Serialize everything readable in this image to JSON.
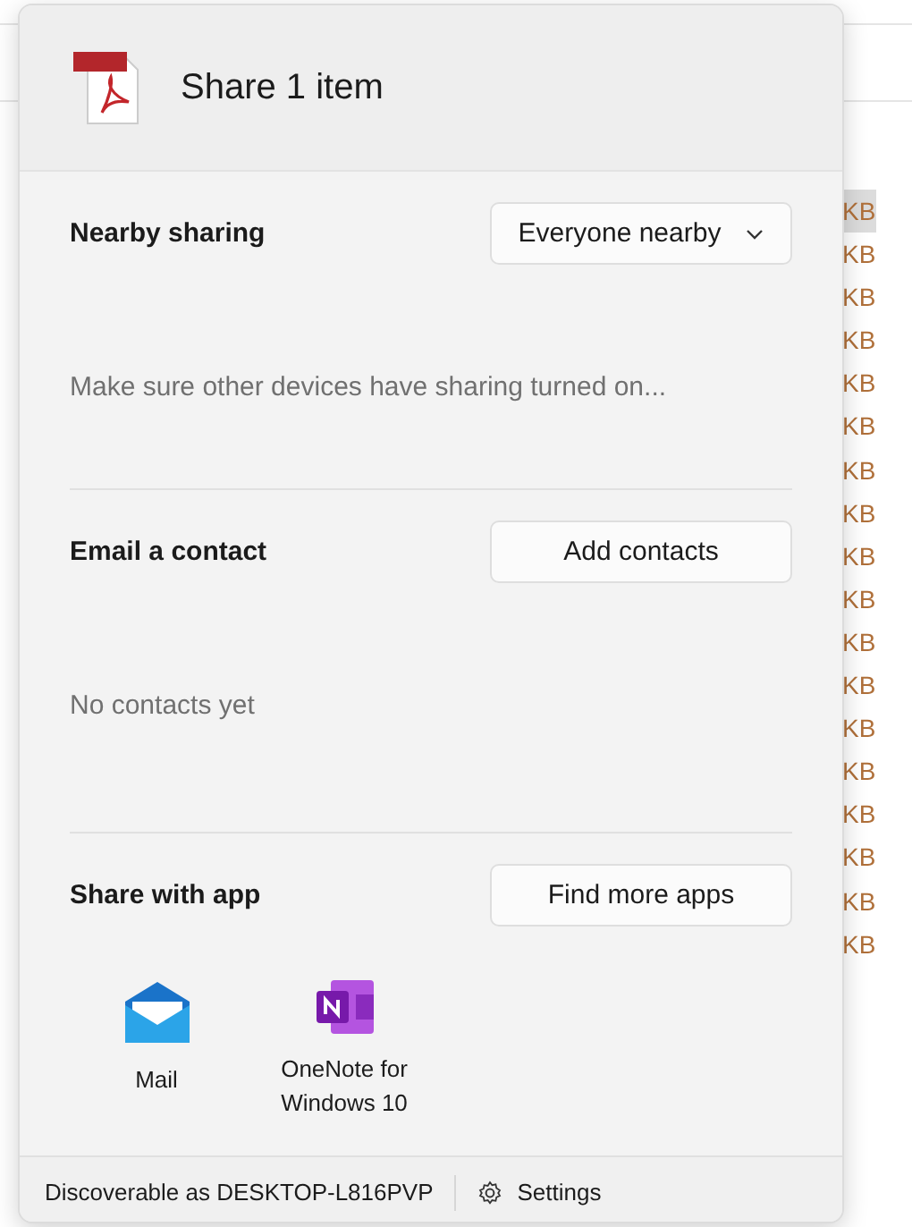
{
  "background_list": {
    "sizes": [
      {
        "text": "KB",
        "selected": true
      },
      {
        "text": "KB",
        "selected": false
      },
      {
        "text": "KB",
        "selected": false
      },
      {
        "text": "KB",
        "selected": false
      },
      {
        "text": "KB",
        "selected": false
      },
      {
        "text": "KB",
        "selected": false
      },
      {
        "text": "KB",
        "selected": false
      },
      {
        "text": "KB",
        "selected": false
      },
      {
        "text": "KB",
        "selected": false
      },
      {
        "text": "KB",
        "selected": false
      },
      {
        "text": "KB",
        "selected": false
      },
      {
        "text": "KB",
        "selected": false
      },
      {
        "text": "KB",
        "selected": false
      },
      {
        "text": "KB",
        "selected": false
      },
      {
        "text": "KB",
        "selected": false
      },
      {
        "text": "KB",
        "selected": false
      },
      {
        "text": "KB",
        "selected": false
      },
      {
        "text": "KB",
        "selected": false
      }
    ]
  },
  "dialog": {
    "title": "Share 1 item",
    "sections": [
      {
        "kind": "dropdown",
        "label": "Nearby sharing",
        "control": "Everyone nearby",
        "message": "Make sure other devices have sharing turned on..."
      },
      {
        "kind": "button",
        "label": "Email a contact",
        "control": "Add contacts",
        "message": "No contacts yet"
      },
      {
        "kind": "apps",
        "label": "Share with app",
        "control": "Find more apps",
        "apps": [
          {
            "kind": "mail",
            "name": "Mail"
          },
          {
            "kind": "onenote",
            "name": "OneNote for Windows 10"
          }
        ]
      }
    ],
    "footer": {
      "status": "Discoverable as DESKTOP-L816PVP",
      "settings": "Settings"
    }
  }
}
